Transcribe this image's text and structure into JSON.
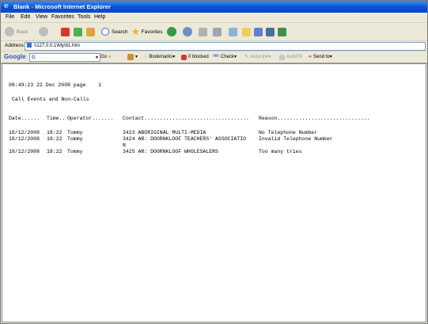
{
  "window": {
    "title": "Blank - Microsoft Internet Explorer"
  },
  "menu": [
    "File",
    "Edit",
    "View",
    "Favorites",
    "Tools",
    "Help"
  ],
  "toolbar": {
    "back_label": "Back",
    "search_label": "Search",
    "favorites_label": "Favorites"
  },
  "address": {
    "label": "Address",
    "url": "\\\\127.0.0.1\\My\\tt1.htm"
  },
  "googlebar": {
    "logo": "Google",
    "search_value": "G",
    "go_label": "Go",
    "bookmarks_label": "Bookmarks",
    "blocked_label": "0 blocked",
    "check_label": "Check",
    "autolink_label": "AutoLink",
    "autofill_label": "AutoFill",
    "sendto_label": "Send to"
  },
  "report": {
    "header_line": "08:49:23 22 Dec 2008 page    1",
    "title": "Call Events and Non-Calls",
    "columns": {
      "date": "Date......",
      "time": "Time..",
      "operator": "Operator.......",
      "contact": "Contact..................................",
      "reason": "Reason.............................."
    },
    "rows": [
      {
        "date": "18/12/2008",
        "time": "18:22",
        "operator": "Tommy",
        "contact": "3423 ABORIGINAL MULTI-MEDIA",
        "contact_wrap": "",
        "reason": "No Telephone Number"
      },
      {
        "date": "18/12/2008",
        "time": "18:22",
        "operator": "Tommy",
        "contact": "3424 AR: DOORNKLOOF TEACHERS' ASSOCIATIO",
        "contact_wrap": "N",
        "reason": "Invalid Telephone Number"
      },
      {
        "date": "18/12/2008",
        "time": "18:22",
        "operator": "Tommy",
        "contact": "3425 AR: DOORNKLOOF WHOLESALERS",
        "contact_wrap": "",
        "reason": "Too many tries"
      }
    ]
  },
  "colors": {
    "titlebar": "#0a4fd6",
    "chrome": "#ece9d8",
    "content": "#ffffff"
  }
}
